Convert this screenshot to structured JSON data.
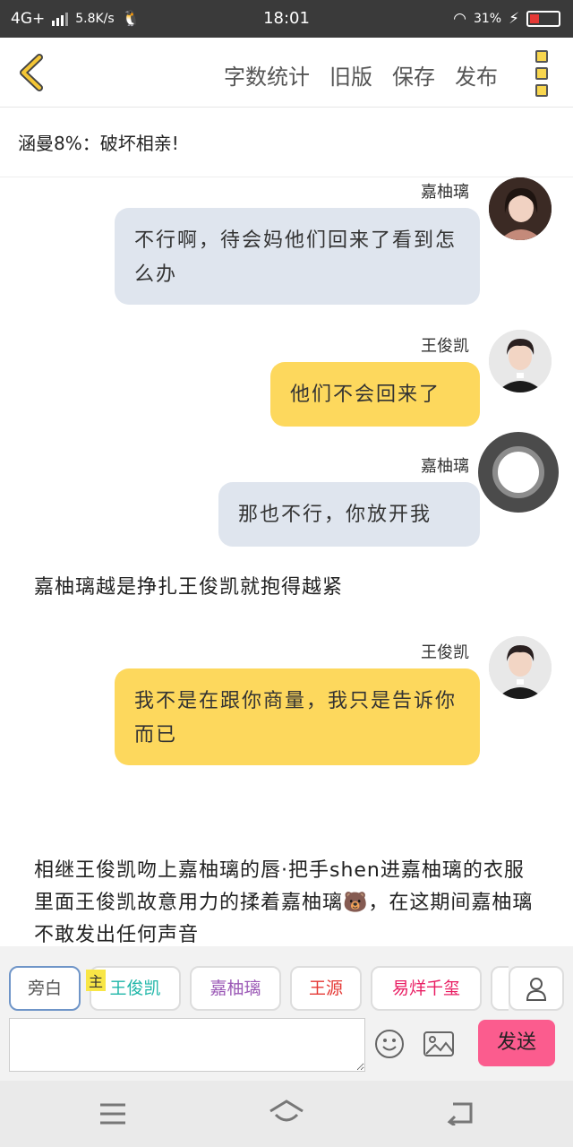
{
  "status": {
    "network": "4G+",
    "speed": "5.8K/s",
    "time": "18:01",
    "battery": "31%"
  },
  "topbar": {
    "menu": [
      "字数统计",
      "旧版",
      "保存",
      "发布"
    ]
  },
  "info": {
    "text": "涵曼8%：破坏相亲!"
  },
  "messages": [
    {
      "name": "嘉柚璃",
      "text": "不行啊，待会妈他们回来了看到怎么办",
      "color": "blue"
    },
    {
      "name": "王俊凯",
      "text": "他们不会回来了",
      "color": "yellow"
    },
    {
      "name": "嘉柚璃",
      "text": "那也不行，你放开我",
      "color": "blue"
    },
    {
      "name": "王俊凯",
      "text": "我不是在跟你商量，我只是告诉你而已",
      "color": "yellow"
    }
  ],
  "narration": [
    "嘉柚璃越是挣扎王俊凯就抱得越紧",
    "相继王俊凯吻上嘉柚璃的唇·把手shen进嘉柚璃的衣服里面王俊凯故意用力的揉着嘉柚璃🐻，在这期间嘉柚璃不敢发出任何声音"
  ],
  "charbar": {
    "chips": [
      {
        "label": "旁白",
        "color": "#555555"
      },
      {
        "label": "王俊凯",
        "color": "#1fb6a8"
      },
      {
        "label": "嘉柚璃",
        "color": "#9b59b6"
      },
      {
        "label": "王源",
        "color": "#e53935"
      },
      {
        "label": "易烊千玺",
        "color": "#e91e63"
      }
    ],
    "main_tag": "主"
  },
  "inputbar": {
    "placeholder": "",
    "send": "发送"
  }
}
